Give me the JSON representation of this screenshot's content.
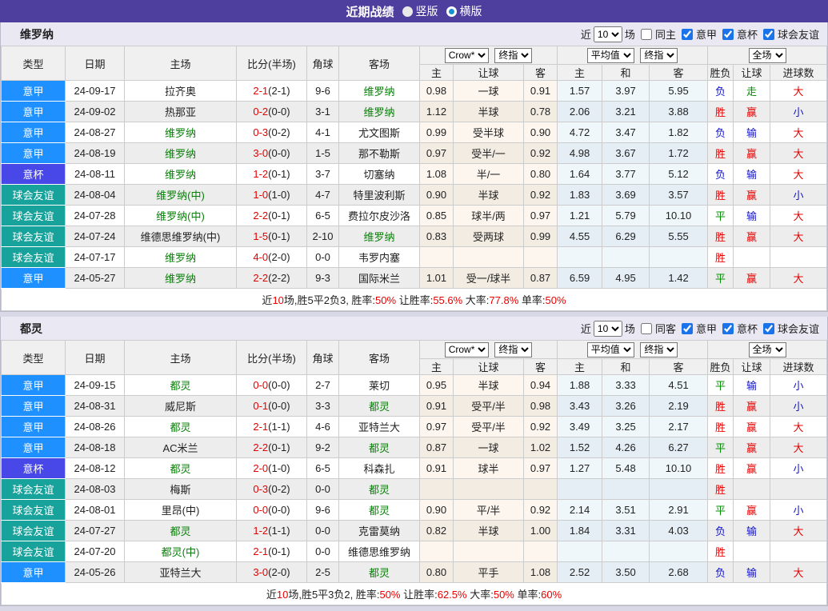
{
  "titlebar": {
    "title": "近期战绩",
    "vertical_label": "竖版",
    "horizontal_label": "横版"
  },
  "filter": {
    "near": "近",
    "count": "10",
    "matches": "场",
    "league1": "意甲",
    "league2": "意杯",
    "league3": "球会友谊"
  },
  "dropdowns": {
    "company": "Crow*",
    "final_index": "终指",
    "average": "平均值",
    "fullmatch": "全场"
  },
  "columns": {
    "type": "类型",
    "date": "日期",
    "home": "主场",
    "score": "比分(半场)",
    "corner": "角球",
    "away": "客场",
    "odds_home": "主",
    "odds_handicap": "让球",
    "odds_away": "客",
    "avg_home": "主",
    "avg_draw": "和",
    "avg_away": "客",
    "result": "胜负",
    "result_handicap": "让球",
    "result_goals": "进球数"
  },
  "type_colors": {
    "意甲": "#1e90ff",
    "意杯": "#4848e8",
    "球会友谊": "#17a29b"
  },
  "tables": [
    {
      "team": "维罗纳",
      "same_label": "同主",
      "rows": [
        {
          "type": "意甲",
          "date": "24-09-17",
          "home": "拉齐奥",
          "home_focus": false,
          "ft": "2-1",
          "ht": "(2-1)",
          "corner": "9-6",
          "away": "维罗纳",
          "away_focus": true,
          "odds": [
            "0.98",
            "一球",
            "0.91"
          ],
          "avg": [
            "1.57",
            "3.97",
            "5.95"
          ],
          "results": [
            [
              "负",
              "blue"
            ],
            [
              "走",
              "green"
            ],
            [
              "大",
              "red"
            ]
          ]
        },
        {
          "type": "意甲",
          "date": "24-09-02",
          "home": "热那亚",
          "home_focus": false,
          "ft": "0-2",
          "ht": "(0-0)",
          "corner": "3-1",
          "away": "维罗纳",
          "away_focus": true,
          "odds": [
            "1.12",
            "半球",
            "0.78"
          ],
          "avg": [
            "2.06",
            "3.21",
            "3.88"
          ],
          "results": [
            [
              "胜",
              "red"
            ],
            [
              "赢",
              "red"
            ],
            [
              "小",
              "blue"
            ]
          ]
        },
        {
          "type": "意甲",
          "date": "24-08-27",
          "home": "维罗纳",
          "home_focus": true,
          "ft": "0-3",
          "ht": "(0-2)",
          "corner": "4-1",
          "away": "尤文图斯",
          "away_focus": false,
          "odds": [
            "0.99",
            "受半球",
            "0.90"
          ],
          "avg": [
            "4.72",
            "3.47",
            "1.82"
          ],
          "results": [
            [
              "负",
              "blue"
            ],
            [
              "输",
              "blue"
            ],
            [
              "大",
              "red"
            ]
          ]
        },
        {
          "type": "意甲",
          "date": "24-08-19",
          "home": "维罗纳",
          "home_focus": true,
          "ft": "3-0",
          "ht": "(0-0)",
          "corner": "1-5",
          "away": "那不勒斯",
          "away_focus": false,
          "odds": [
            "0.97",
            "受半/一",
            "0.92"
          ],
          "avg": [
            "4.98",
            "3.67",
            "1.72"
          ],
          "results": [
            [
              "胜",
              "red"
            ],
            [
              "赢",
              "red"
            ],
            [
              "大",
              "red"
            ]
          ]
        },
        {
          "type": "意杯",
          "date": "24-08-11",
          "home": "维罗纳",
          "home_focus": true,
          "ft": "1-2",
          "ht": "(0-1)",
          "corner": "3-7",
          "away": "切塞纳",
          "away_focus": false,
          "odds": [
            "1.08",
            "半/一",
            "0.80"
          ],
          "avg": [
            "1.64",
            "3.77",
            "5.12"
          ],
          "results": [
            [
              "负",
              "blue"
            ],
            [
              "输",
              "blue"
            ],
            [
              "大",
              "red"
            ]
          ]
        },
        {
          "type": "球会友谊",
          "date": "24-08-04",
          "home": "维罗纳(中)",
          "home_focus": true,
          "ft": "1-0",
          "ht": "(1-0)",
          "corner": "4-7",
          "away": "特里波利斯",
          "away_focus": false,
          "odds": [
            "0.90",
            "半球",
            "0.92"
          ],
          "avg": [
            "1.83",
            "3.69",
            "3.57"
          ],
          "results": [
            [
              "胜",
              "red"
            ],
            [
              "赢",
              "red"
            ],
            [
              "小",
              "blue"
            ]
          ]
        },
        {
          "type": "球会友谊",
          "date": "24-07-28",
          "home": "维罗纳(中)",
          "home_focus": true,
          "ft": "2-2",
          "ht": "(0-1)",
          "corner": "6-5",
          "away": "费拉尔皮沙洛",
          "away_focus": false,
          "odds": [
            "0.85",
            "球半/两",
            "0.97"
          ],
          "avg": [
            "1.21",
            "5.79",
            "10.10"
          ],
          "results": [
            [
              "平",
              "green"
            ],
            [
              "输",
              "blue"
            ],
            [
              "大",
              "red"
            ]
          ]
        },
        {
          "type": "球会友谊",
          "date": "24-07-24",
          "home": "维德思维罗纳(中)",
          "home_focus": false,
          "ft": "1-5",
          "ht": "(0-1)",
          "corner": "2-10",
          "away": "维罗纳",
          "away_focus": true,
          "odds": [
            "0.83",
            "受两球",
            "0.99"
          ],
          "avg": [
            "4.55",
            "6.29",
            "5.55"
          ],
          "results": [
            [
              "胜",
              "red"
            ],
            [
              "赢",
              "red"
            ],
            [
              "大",
              "red"
            ]
          ]
        },
        {
          "type": "球会友谊",
          "date": "24-07-17",
          "home": "维罗纳",
          "home_focus": true,
          "ft": "4-0",
          "ht": "(2-0)",
          "corner": "0-0",
          "away": "韦罗内塞",
          "away_focus": false,
          "odds": [
            "",
            "",
            ""
          ],
          "avg": [
            "",
            "",
            ""
          ],
          "results": [
            [
              "胜",
              "red"
            ],
            [
              "",
              ""
            ],
            [
              "",
              ""
            ]
          ]
        },
        {
          "type": "意甲",
          "date": "24-05-27",
          "home": "维罗纳",
          "home_focus": true,
          "ft": "2-2",
          "ht": "(2-2)",
          "corner": "9-3",
          "away": "国际米兰",
          "away_focus": false,
          "odds": [
            "1.01",
            "受一/球半",
            "0.87"
          ],
          "avg": [
            "6.59",
            "4.95",
            "1.42"
          ],
          "results": [
            [
              "平",
              "green"
            ],
            [
              "赢",
              "red"
            ],
            [
              "大",
              "red"
            ]
          ]
        }
      ],
      "summary": [
        [
          "近",
          false
        ],
        [
          "10",
          true
        ],
        [
          "场,胜5平2负3, 胜率:",
          false
        ],
        [
          "50%",
          true
        ],
        [
          " 让胜率:",
          false
        ],
        [
          "55.6%",
          true
        ],
        [
          " 大率:",
          false
        ],
        [
          "77.8%",
          true
        ],
        [
          " 单率:",
          false
        ],
        [
          "50%",
          true
        ]
      ]
    },
    {
      "team": "都灵",
      "same_label": "同客",
      "rows": [
        {
          "type": "意甲",
          "date": "24-09-15",
          "home": "都灵",
          "home_focus": true,
          "ft": "0-0",
          "ht": "(0-0)",
          "corner": "2-7",
          "away": "莱切",
          "away_focus": false,
          "odds": [
            "0.95",
            "半球",
            "0.94"
          ],
          "avg": [
            "1.88",
            "3.33",
            "4.51"
          ],
          "results": [
            [
              "平",
              "green"
            ],
            [
              "输",
              "blue"
            ],
            [
              "小",
              "blue"
            ]
          ]
        },
        {
          "type": "意甲",
          "date": "24-08-31",
          "home": "威尼斯",
          "home_focus": false,
          "ft": "0-1",
          "ht": "(0-0)",
          "corner": "3-3",
          "away": "都灵",
          "away_focus": true,
          "odds": [
            "0.91",
            "受平/半",
            "0.98"
          ],
          "avg": [
            "3.43",
            "3.26",
            "2.19"
          ],
          "results": [
            [
              "胜",
              "red"
            ],
            [
              "赢",
              "red"
            ],
            [
              "小",
              "blue"
            ]
          ]
        },
        {
          "type": "意甲",
          "date": "24-08-26",
          "home": "都灵",
          "home_focus": true,
          "ft": "2-1",
          "ht": "(1-1)",
          "corner": "4-6",
          "away": "亚特兰大",
          "away_focus": false,
          "odds": [
            "0.97",
            "受平/半",
            "0.92"
          ],
          "avg": [
            "3.49",
            "3.25",
            "2.17"
          ],
          "results": [
            [
              "胜",
              "red"
            ],
            [
              "赢",
              "red"
            ],
            [
              "大",
              "red"
            ]
          ]
        },
        {
          "type": "意甲",
          "date": "24-08-18",
          "home": "AC米兰",
          "home_focus": false,
          "ft": "2-2",
          "ht": "(0-1)",
          "corner": "9-2",
          "away": "都灵",
          "away_focus": true,
          "odds": [
            "0.87",
            "一球",
            "1.02"
          ],
          "avg": [
            "1.52",
            "4.26",
            "6.27"
          ],
          "results": [
            [
              "平",
              "green"
            ],
            [
              "赢",
              "red"
            ],
            [
              "大",
              "red"
            ]
          ]
        },
        {
          "type": "意杯",
          "date": "24-08-12",
          "home": "都灵",
          "home_focus": true,
          "ft": "2-0",
          "ht": "(1-0)",
          "corner": "6-5",
          "away": "科森扎",
          "away_focus": false,
          "odds": [
            "0.91",
            "球半",
            "0.97"
          ],
          "avg": [
            "1.27",
            "5.48",
            "10.10"
          ],
          "results": [
            [
              "胜",
              "red"
            ],
            [
              "赢",
              "red"
            ],
            [
              "小",
              "blue"
            ]
          ]
        },
        {
          "type": "球会友谊",
          "date": "24-08-03",
          "home": "梅斯",
          "home_focus": false,
          "ft": "0-3",
          "ht": "(0-2)",
          "corner": "0-0",
          "away": "都灵",
          "away_focus": true,
          "odds": [
            "",
            "",
            ""
          ],
          "avg": [
            "",
            "",
            ""
          ],
          "results": [
            [
              "胜",
              "red"
            ],
            [
              "",
              ""
            ],
            [
              "",
              ""
            ]
          ]
        },
        {
          "type": "球会友谊",
          "date": "24-08-01",
          "home": "里昂(中)",
          "home_focus": false,
          "ft": "0-0",
          "ht": "(0-0)",
          "corner": "9-6",
          "away": "都灵",
          "away_focus": true,
          "odds": [
            "0.90",
            "平/半",
            "0.92"
          ],
          "avg": [
            "2.14",
            "3.51",
            "2.91"
          ],
          "results": [
            [
              "平",
              "green"
            ],
            [
              "赢",
              "red"
            ],
            [
              "小",
              "blue"
            ]
          ]
        },
        {
          "type": "球会友谊",
          "date": "24-07-27",
          "home": "都灵",
          "home_focus": true,
          "ft": "1-2",
          "ht": "(1-1)",
          "corner": "0-0",
          "away": "克雷莫纳",
          "away_focus": false,
          "odds": [
            "0.82",
            "半球",
            "1.00"
          ],
          "avg": [
            "1.84",
            "3.31",
            "4.03"
          ],
          "results": [
            [
              "负",
              "blue"
            ],
            [
              "输",
              "blue"
            ],
            [
              "大",
              "red"
            ]
          ]
        },
        {
          "type": "球会友谊",
          "date": "24-07-20",
          "home": "都灵(中)",
          "home_focus": true,
          "ft": "2-1",
          "ht": "(0-1)",
          "corner": "0-0",
          "away": "维德思维罗纳",
          "away_focus": false,
          "odds": [
            "",
            "",
            ""
          ],
          "avg": [
            "",
            "",
            ""
          ],
          "results": [
            [
              "胜",
              "red"
            ],
            [
              "",
              ""
            ],
            [
              "",
              ""
            ]
          ]
        },
        {
          "type": "意甲",
          "date": "24-05-26",
          "home": "亚特兰大",
          "home_focus": false,
          "ft": "3-0",
          "ht": "(2-0)",
          "corner": "2-5",
          "away": "都灵",
          "away_focus": true,
          "odds": [
            "0.80",
            "平手",
            "1.08"
          ],
          "avg": [
            "2.52",
            "3.50",
            "2.68"
          ],
          "results": [
            [
              "负",
              "blue"
            ],
            [
              "输",
              "blue"
            ],
            [
              "大",
              "red"
            ]
          ]
        }
      ],
      "summary": [
        [
          "近",
          false
        ],
        [
          "10",
          true
        ],
        [
          "场,胜5平3负2, 胜率:",
          false
        ],
        [
          "50%",
          true
        ],
        [
          " 让胜率:",
          false
        ],
        [
          "62.5%",
          true
        ],
        [
          " 大率:",
          false
        ],
        [
          "50%",
          true
        ],
        [
          " 单率:",
          false
        ],
        [
          "60%",
          true
        ]
      ]
    }
  ]
}
